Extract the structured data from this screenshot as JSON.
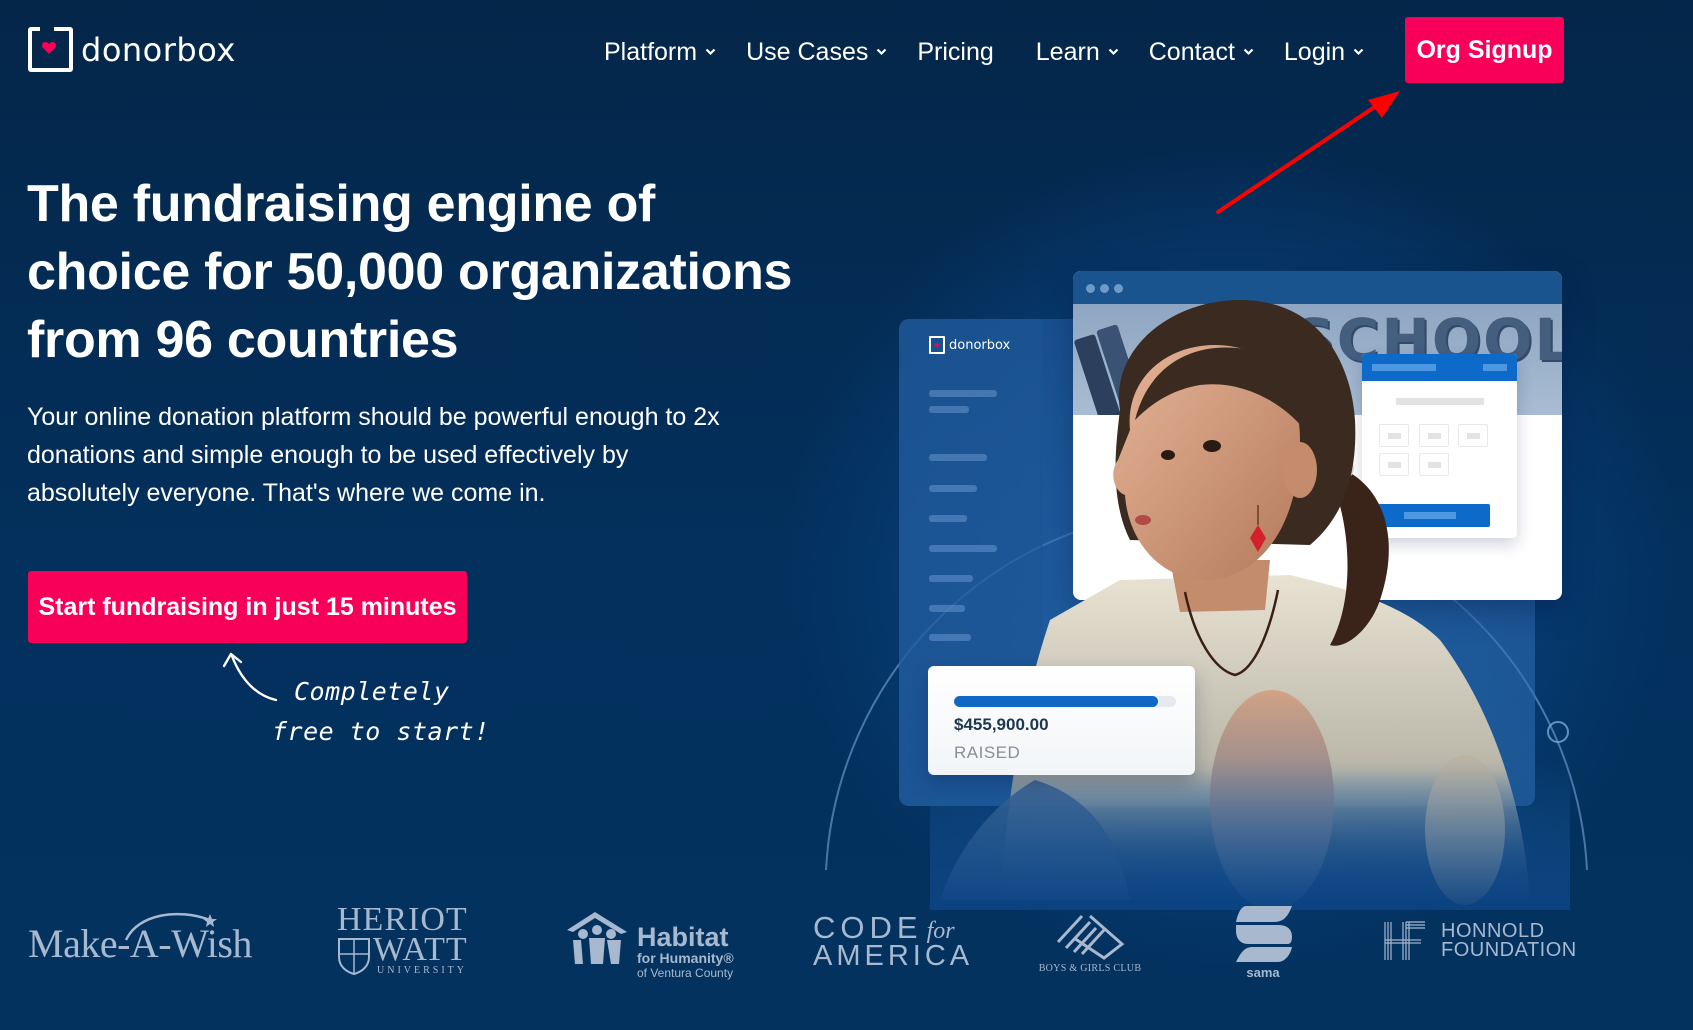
{
  "header": {
    "logo_text": "donorbox",
    "nav": [
      {
        "label": "Platform",
        "has_dropdown": true
      },
      {
        "label": "Use Cases",
        "has_dropdown": true
      },
      {
        "label": "Pricing",
        "has_dropdown": false
      },
      {
        "label": "Learn",
        "has_dropdown": true
      },
      {
        "label": "Contact",
        "has_dropdown": true
      },
      {
        "label": "Login",
        "has_dropdown": true
      }
    ],
    "signup_label": "Org Signup"
  },
  "hero": {
    "headline": "The fundraising engine of choice for 50,000 organizations from 96 countries",
    "subtext": "Your online donation platform should be powerful enough to 2x donations and simple enough to be used effectively by absolutely everyone. That's where we come in.",
    "cta_label": "Start fundraising in just 15 minutes",
    "hint_line1": "Completely",
    "hint_line2": "free to start!"
  },
  "illustration": {
    "mini_logo_text": "donorbox",
    "banner_word": "SCHOOL",
    "raised_amount": "$455,900.00",
    "raised_label": "RAISED",
    "progress_percent": 92
  },
  "partners": [
    {
      "name": "Make-A-Wish"
    },
    {
      "name_line1": "HERIOT",
      "name_line2": "WATT",
      "name_line3": "UNIVERSITY"
    },
    {
      "name_line1": "Habitat",
      "name_line2": "for Humanity®",
      "name_line3": "of Ventura County"
    },
    {
      "name_line1": "CODE",
      "name_for": "for",
      "name_line2": "AMERICA"
    },
    {
      "name": "BOYS & GIRLS CLUB"
    },
    {
      "name": "sama"
    },
    {
      "name_line1": "HONNOLD",
      "name_line2": "FOUNDATION"
    }
  ],
  "colors": {
    "brand_pink": "#f8005a",
    "background_navy": "#03305d",
    "annotation_red": "#ff0000",
    "progress_blue": "#1167c4"
  }
}
